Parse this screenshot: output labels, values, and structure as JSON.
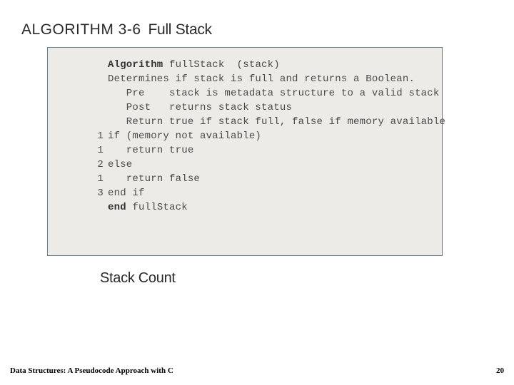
{
  "heading": {
    "label": "ALGORITHM 3-6",
    "name": "Full Stack"
  },
  "code": {
    "l1_a": "Algorithm",
    "l1_b": " fullStack  (stack)",
    "l2": "Determines if stack is full and returns a Boolean.",
    "l3": "   Pre    stack is metadata structure to a valid stack",
    "l4": "   Post   returns stack status",
    "l5": "   Return true if stack full, false if memory available",
    "n6": "1",
    "l6": "if (memory not available)",
    "n7": "1",
    "l7": "   return true",
    "n8": "2",
    "l8": "else",
    "n9": "1",
    "l9": "   return false",
    "n10": "3",
    "l10": "end if",
    "l11_a": "end",
    "l11_b": " fullStack"
  },
  "sub_heading": "Stack Count",
  "footer": {
    "left": "Data Structures: A Pseudocode Approach with C",
    "right": "20"
  }
}
